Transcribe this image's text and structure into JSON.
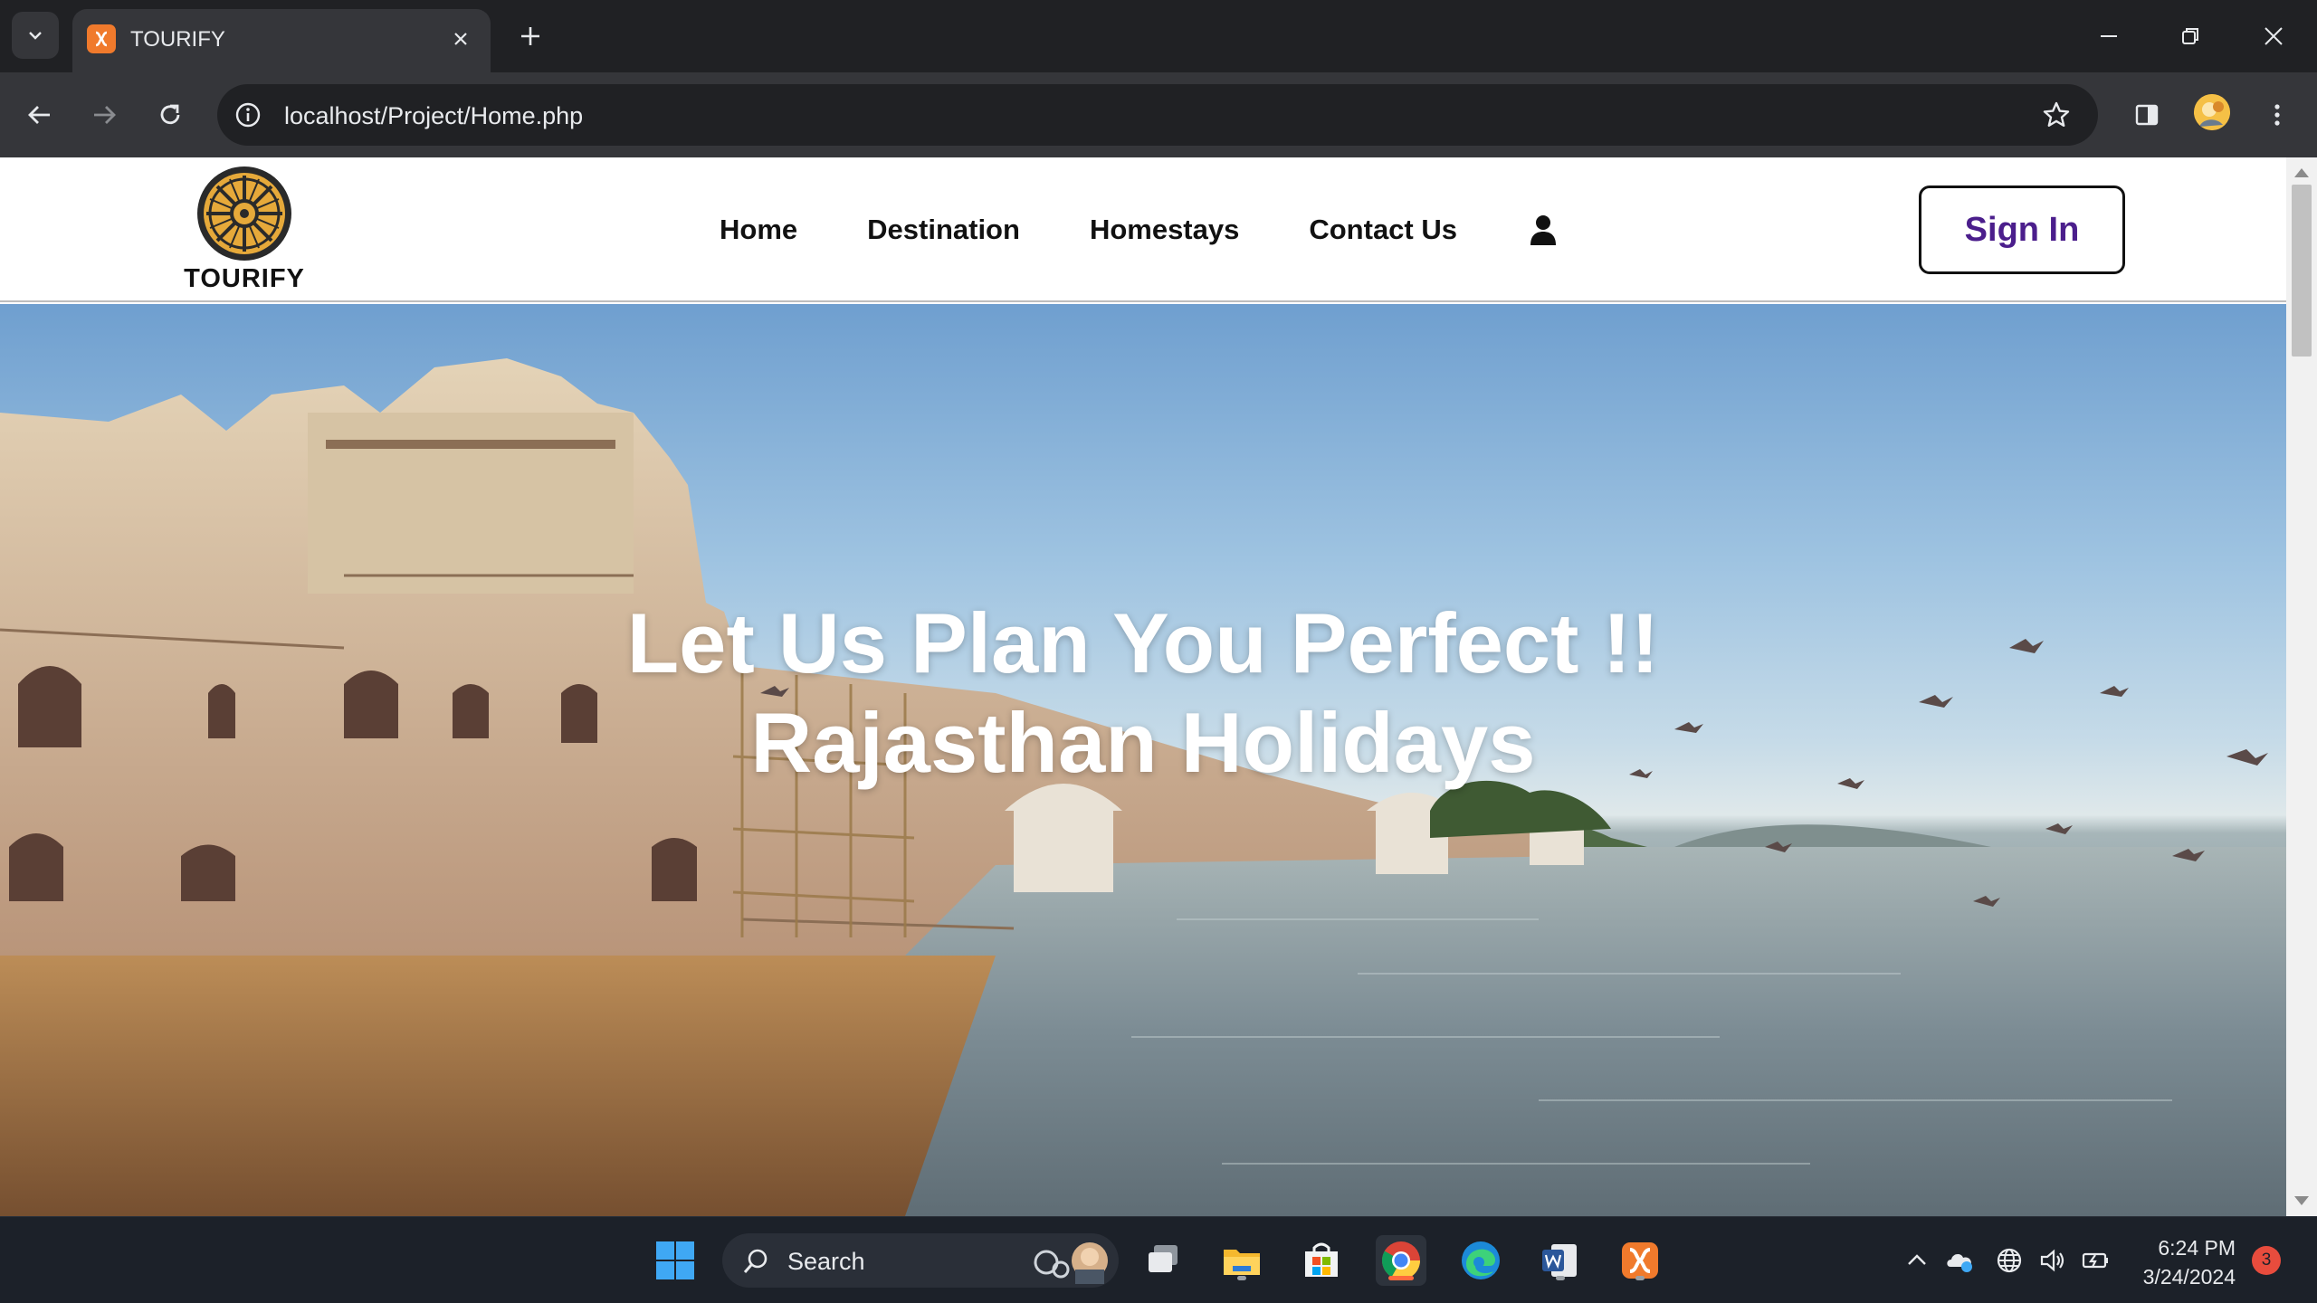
{
  "browser": {
    "tab_title": "TOURIFY",
    "url": "localhost/Project/Home.php"
  },
  "site": {
    "logo_text": "TOURIFY",
    "nav": [
      "Home",
      "Destination",
      "Homestays",
      "Contact Us"
    ],
    "signin_label": "Sign In",
    "hero_line1": "Let Us Plan You Perfect !!",
    "hero_line2": "Rajasthan Holidays"
  },
  "taskbar": {
    "search_label": "Search",
    "time": "6:24 PM",
    "date": "3/24/2024",
    "notification_count": "3"
  },
  "colors": {
    "browser_bg": "#202124",
    "toolbar_bg": "#35363a",
    "signin_text": "#4b1e8c",
    "taskbar_bg": "#1c2129",
    "active_indicator": "#ff6a3d"
  }
}
